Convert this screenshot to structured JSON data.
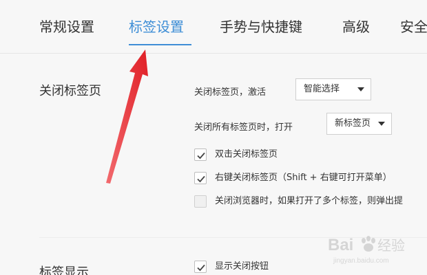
{
  "tabs": [
    {
      "label": "常规设置"
    },
    {
      "label": "标签设置"
    },
    {
      "label": "手势与快捷键"
    },
    {
      "label": "高级"
    },
    {
      "label": "安全"
    }
  ],
  "close_tab_section": {
    "title": "关闭标签页",
    "activate": {
      "label": "关闭标签页，激活",
      "selected": "智能选择"
    },
    "close_all": {
      "label": "关闭所有标签页时，打开",
      "selected": "新标签页"
    },
    "options": [
      {
        "label": "双击关闭标签页",
        "checked": true
      },
      {
        "label": "右键关闭标签页（Shift + 右键可打开菜单）",
        "checked": true
      },
      {
        "label": "关闭浏览器时，如果打开了多个标签，则弹出提",
        "checked": false
      }
    ]
  },
  "tab_display_section": {
    "title": "标签显示",
    "options": [
      {
        "label": "显示关闭按钮",
        "checked": true
      }
    ]
  },
  "colors": {
    "accent": "#3e8ed6",
    "annotation_arrow": "#e8232a"
  },
  "watermark": {
    "brand": "Bai",
    "brand2": "经验",
    "url": "jingyan.baidu.com"
  }
}
